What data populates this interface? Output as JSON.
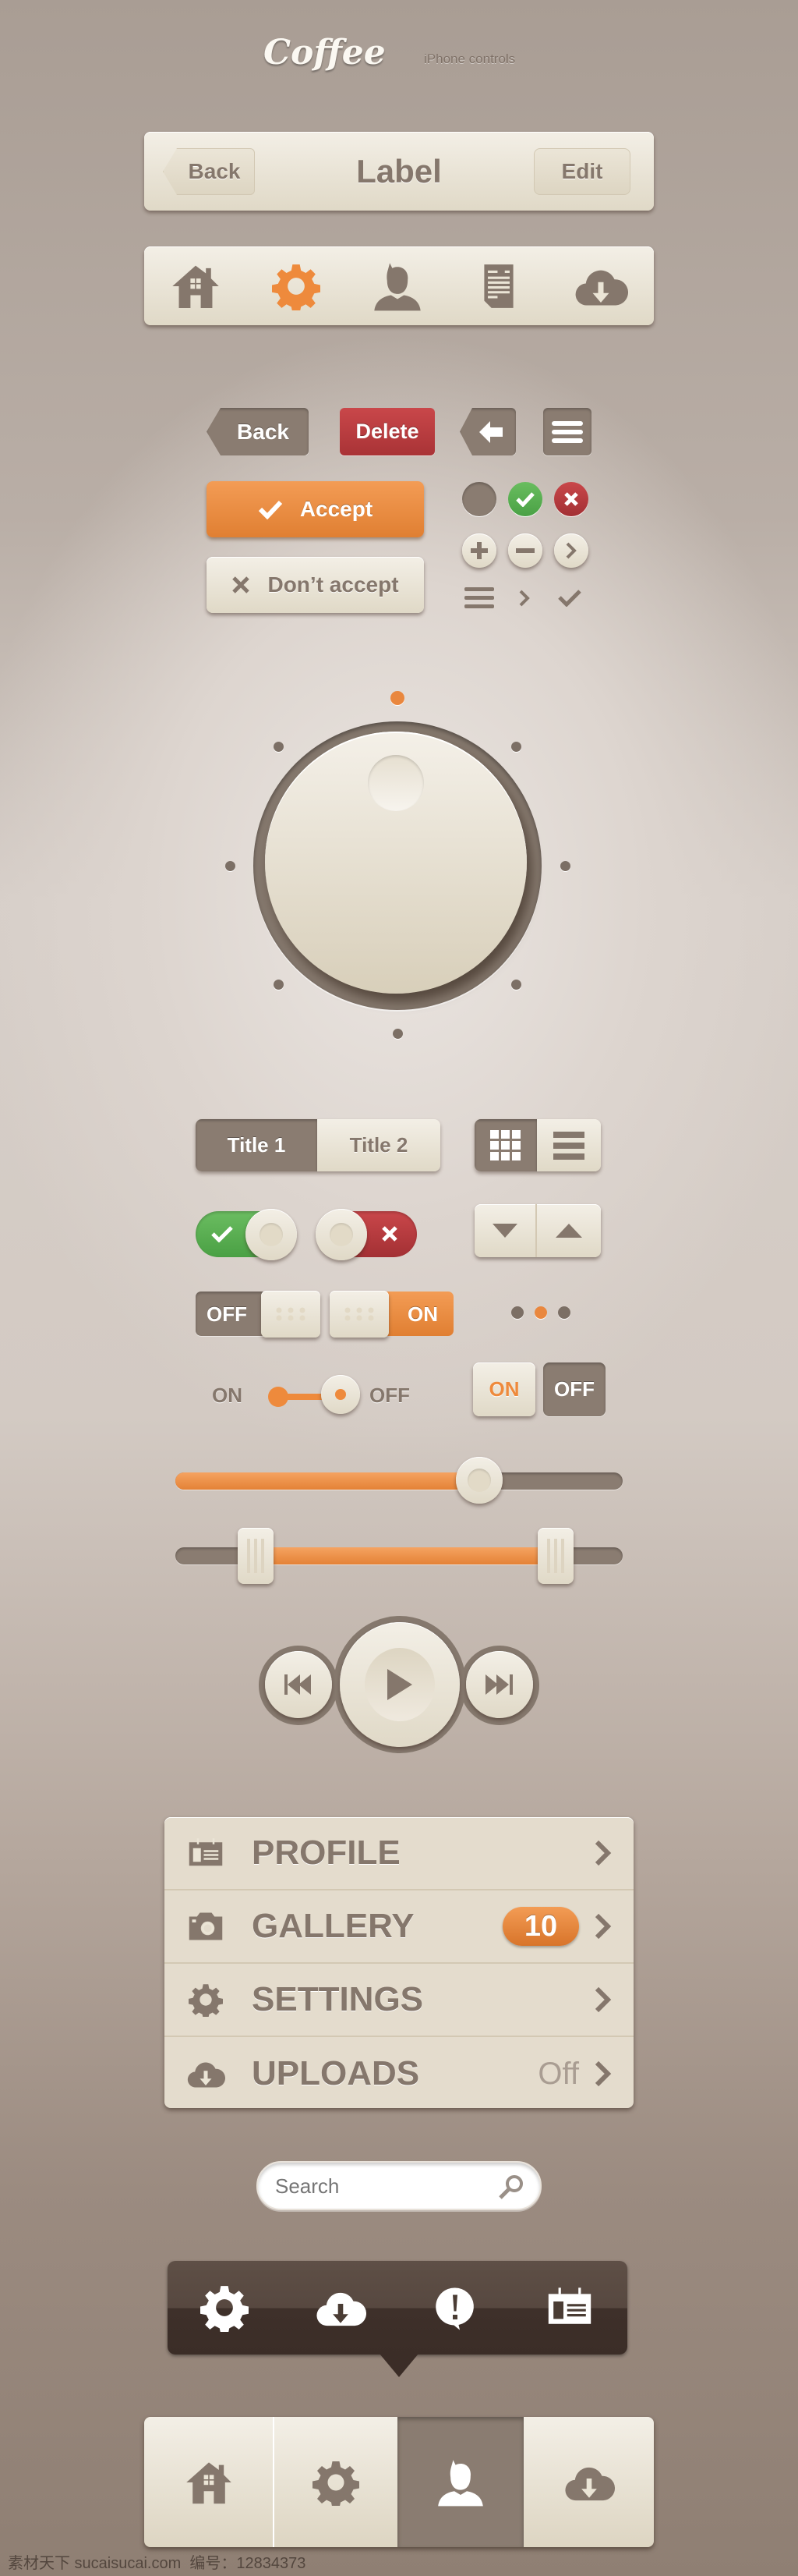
{
  "header": {
    "logo": "Coffee",
    "subtitle": "iPhone controls"
  },
  "navbar": {
    "back": "Back",
    "title": "Label",
    "edit": "Edit"
  },
  "tabbar_top": {
    "icons": [
      "home-icon",
      "gear-icon",
      "user-icon",
      "document-icon",
      "cloud-download-icon"
    ],
    "active": "gear-icon"
  },
  "buttons": {
    "back": "Back",
    "delete": "Delete",
    "accept": "Accept",
    "dont_accept": "Don’t accept"
  },
  "knob": {
    "positions": 8,
    "selected_position": 0
  },
  "segmented": {
    "title1": "Title 1",
    "title2": "Title 2",
    "selected": "Title 1",
    "view_selected": "grid"
  },
  "toggles": {
    "off_label": "OFF",
    "on_label": "ON",
    "small_on": "ON",
    "small_off": "OFF",
    "btn_on": "ON",
    "btn_off": "OFF"
  },
  "page_indicator": {
    "count": 3,
    "active": 2
  },
  "slider": {
    "value": 0.68
  },
  "range_slider": {
    "low": 0.18,
    "high": 0.85
  },
  "list": {
    "items": [
      {
        "icon": "profile-card-icon",
        "label": "PROFILE"
      },
      {
        "icon": "camera-icon",
        "label": "GALLERY",
        "badge": "10"
      },
      {
        "icon": "gear-icon",
        "label": "SETTINGS"
      },
      {
        "icon": "cloud-download-icon",
        "label": "UPLOADS",
        "value": "Off"
      }
    ]
  },
  "search": {
    "placeholder": "Search"
  },
  "popover": {
    "icons": [
      "gear-icon",
      "cloud-download-icon",
      "alert-bubble-icon",
      "calendar-card-icon"
    ]
  },
  "tabbar_bottom": {
    "icons": [
      "home-icon",
      "gear-icon",
      "user-icon",
      "cloud-download-icon"
    ],
    "active": "user-icon"
  },
  "watermark": "素材天下 sucaisucai.com  编号：12834373",
  "colors": {
    "accent": "#e9873e",
    "brown": "#8a7c71",
    "cream": "#ece6d8",
    "delete": "#b5393c",
    "success": "#5aad55",
    "popover": "#4a3c34"
  }
}
